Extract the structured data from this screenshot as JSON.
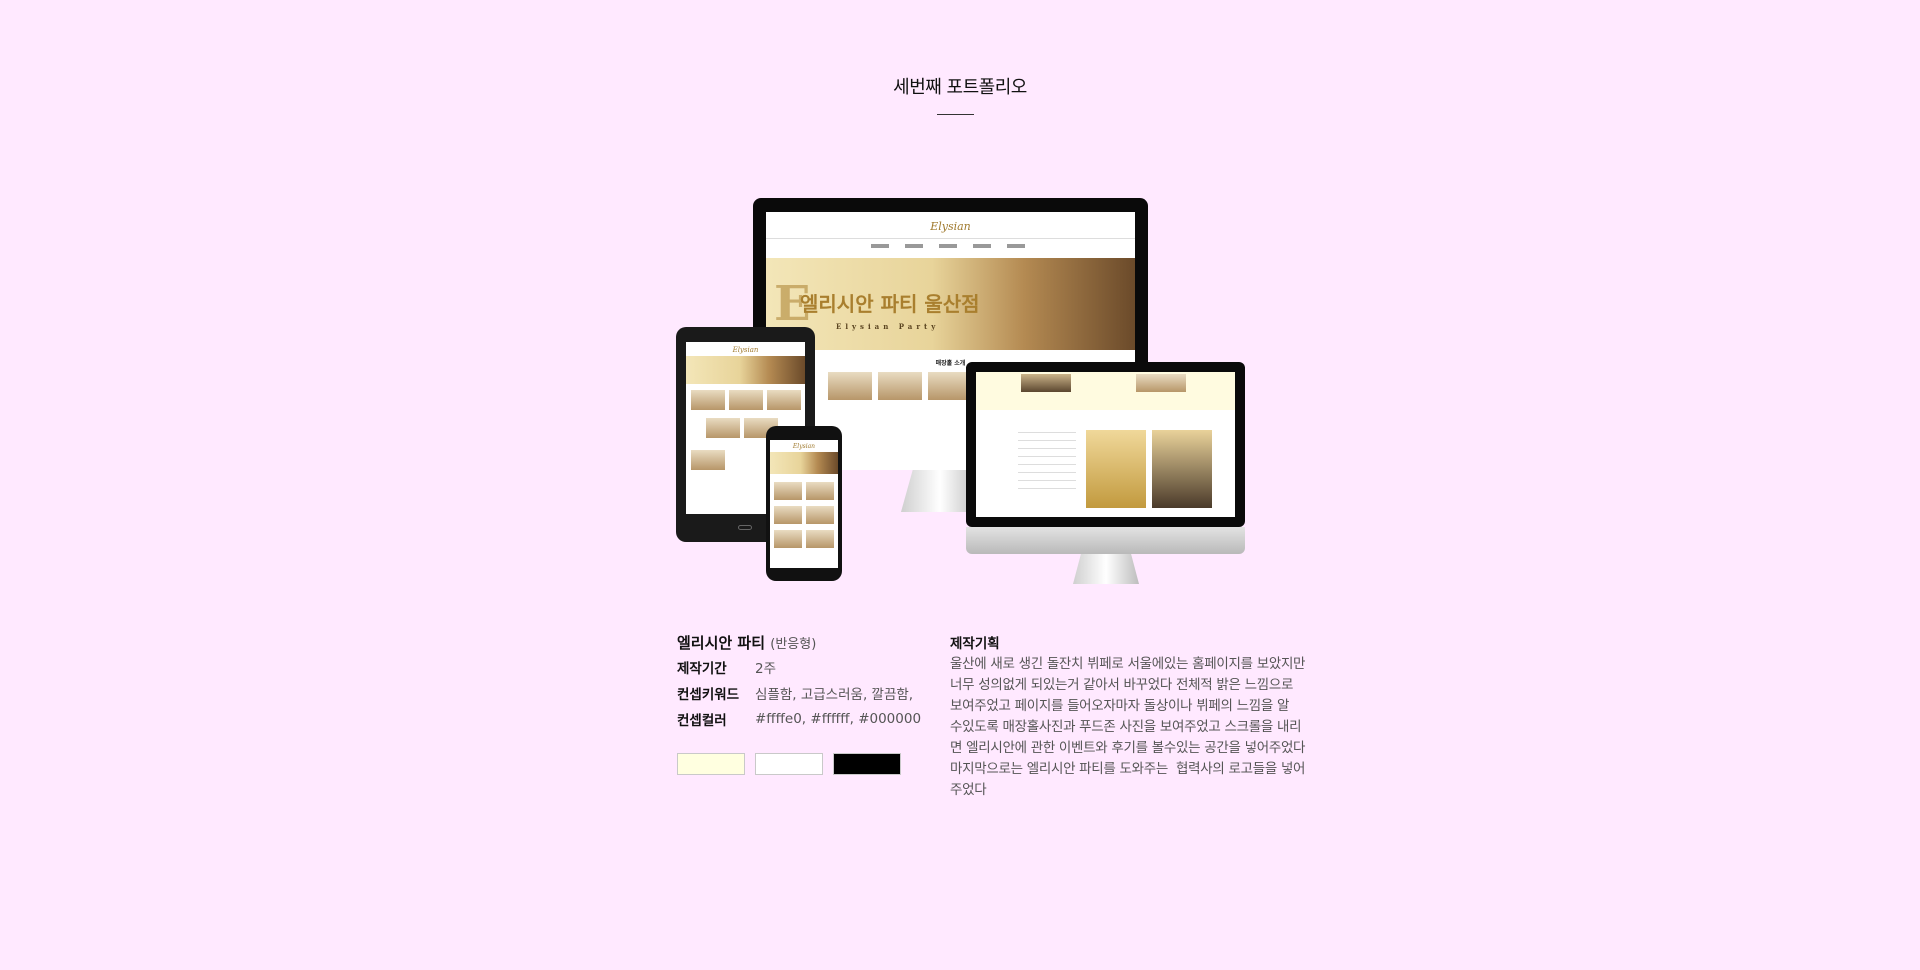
{
  "section": {
    "title": "세번째 포트폴리오"
  },
  "mockup": {
    "site_logo": "Elysian",
    "banner_title": "엘리시안 파티 울산점",
    "banner_sub": "Elysian Party",
    "menu_heading": "매장홀 소개"
  },
  "project": {
    "name": "엘리시안 파티",
    "type": "(반응형)",
    "details": [
      {
        "label": "제작기간",
        "value": "2주"
      },
      {
        "label": "컨셉키워드",
        "value": "심플함, 고급스러움, 깔끔함,"
      },
      {
        "label": "컨셉컬러",
        "value": "#ffffe0, #ffffff, #000000"
      }
    ],
    "colors": [
      "#ffffe0",
      "#ffffff",
      "#000000"
    ]
  },
  "plan": {
    "heading": "제작기획",
    "lines": [
      "울산에 새로 생긴 돌잔치 뷔페로 서울에있는 홈페이지를 보았지만",
      "너무 성의없게 되있는거 같아서 바꾸었다 전체적 밝은 느낌으로",
      "보여주었고 페이지를 들어오자마자 돌상이나 뷔페의 느낌을 알",
      "수있도록 매장홀사진과 푸드존 사진을 보여주었고 스크롤을 내리",
      "면 엘리시안에 관한 이벤트와 후기를 볼수있는 공간을 넣어주었다",
      "마지막으로는 엘리시안 파티를 도와주는  협력사의 로고들을 넣어",
      "주었다"
    ]
  }
}
